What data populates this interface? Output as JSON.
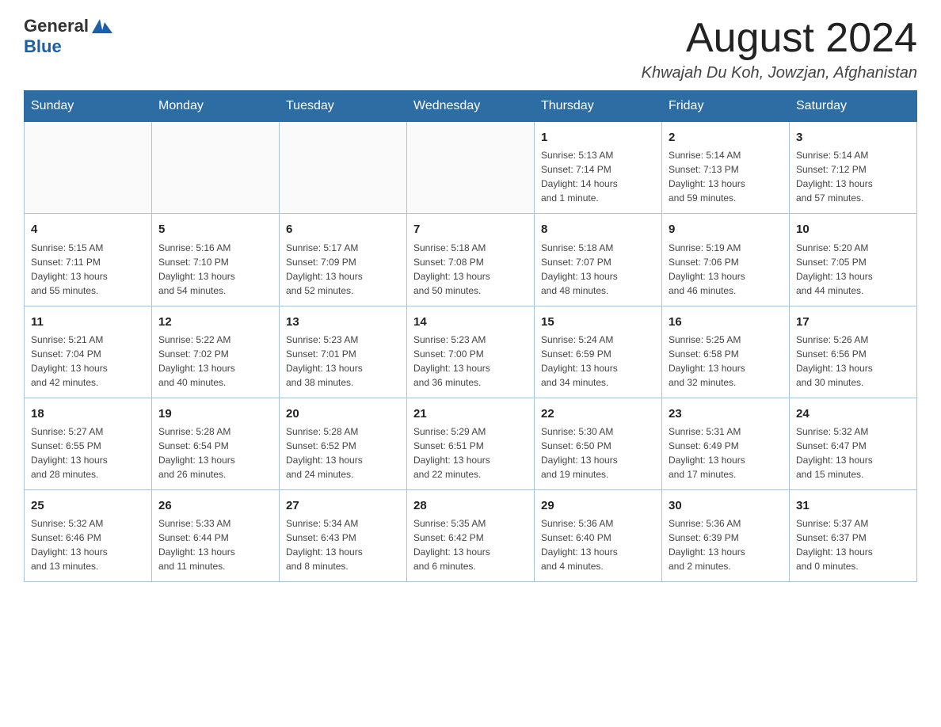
{
  "header": {
    "logo_general": "General",
    "logo_blue": "Blue",
    "month_title": "August 2024",
    "location": "Khwajah Du Koh, Jowzjan, Afghanistan"
  },
  "days_of_week": [
    "Sunday",
    "Monday",
    "Tuesday",
    "Wednesday",
    "Thursday",
    "Friday",
    "Saturday"
  ],
  "weeks": [
    [
      {
        "day": "",
        "info": ""
      },
      {
        "day": "",
        "info": ""
      },
      {
        "day": "",
        "info": ""
      },
      {
        "day": "",
        "info": ""
      },
      {
        "day": "1",
        "info": "Sunrise: 5:13 AM\nSunset: 7:14 PM\nDaylight: 14 hours\nand 1 minute."
      },
      {
        "day": "2",
        "info": "Sunrise: 5:14 AM\nSunset: 7:13 PM\nDaylight: 13 hours\nand 59 minutes."
      },
      {
        "day": "3",
        "info": "Sunrise: 5:14 AM\nSunset: 7:12 PM\nDaylight: 13 hours\nand 57 minutes."
      }
    ],
    [
      {
        "day": "4",
        "info": "Sunrise: 5:15 AM\nSunset: 7:11 PM\nDaylight: 13 hours\nand 55 minutes."
      },
      {
        "day": "5",
        "info": "Sunrise: 5:16 AM\nSunset: 7:10 PM\nDaylight: 13 hours\nand 54 minutes."
      },
      {
        "day": "6",
        "info": "Sunrise: 5:17 AM\nSunset: 7:09 PM\nDaylight: 13 hours\nand 52 minutes."
      },
      {
        "day": "7",
        "info": "Sunrise: 5:18 AM\nSunset: 7:08 PM\nDaylight: 13 hours\nand 50 minutes."
      },
      {
        "day": "8",
        "info": "Sunrise: 5:18 AM\nSunset: 7:07 PM\nDaylight: 13 hours\nand 48 minutes."
      },
      {
        "day": "9",
        "info": "Sunrise: 5:19 AM\nSunset: 7:06 PM\nDaylight: 13 hours\nand 46 minutes."
      },
      {
        "day": "10",
        "info": "Sunrise: 5:20 AM\nSunset: 7:05 PM\nDaylight: 13 hours\nand 44 minutes."
      }
    ],
    [
      {
        "day": "11",
        "info": "Sunrise: 5:21 AM\nSunset: 7:04 PM\nDaylight: 13 hours\nand 42 minutes."
      },
      {
        "day": "12",
        "info": "Sunrise: 5:22 AM\nSunset: 7:02 PM\nDaylight: 13 hours\nand 40 minutes."
      },
      {
        "day": "13",
        "info": "Sunrise: 5:23 AM\nSunset: 7:01 PM\nDaylight: 13 hours\nand 38 minutes."
      },
      {
        "day": "14",
        "info": "Sunrise: 5:23 AM\nSunset: 7:00 PM\nDaylight: 13 hours\nand 36 minutes."
      },
      {
        "day": "15",
        "info": "Sunrise: 5:24 AM\nSunset: 6:59 PM\nDaylight: 13 hours\nand 34 minutes."
      },
      {
        "day": "16",
        "info": "Sunrise: 5:25 AM\nSunset: 6:58 PM\nDaylight: 13 hours\nand 32 minutes."
      },
      {
        "day": "17",
        "info": "Sunrise: 5:26 AM\nSunset: 6:56 PM\nDaylight: 13 hours\nand 30 minutes."
      }
    ],
    [
      {
        "day": "18",
        "info": "Sunrise: 5:27 AM\nSunset: 6:55 PM\nDaylight: 13 hours\nand 28 minutes."
      },
      {
        "day": "19",
        "info": "Sunrise: 5:28 AM\nSunset: 6:54 PM\nDaylight: 13 hours\nand 26 minutes."
      },
      {
        "day": "20",
        "info": "Sunrise: 5:28 AM\nSunset: 6:52 PM\nDaylight: 13 hours\nand 24 minutes."
      },
      {
        "day": "21",
        "info": "Sunrise: 5:29 AM\nSunset: 6:51 PM\nDaylight: 13 hours\nand 22 minutes."
      },
      {
        "day": "22",
        "info": "Sunrise: 5:30 AM\nSunset: 6:50 PM\nDaylight: 13 hours\nand 19 minutes."
      },
      {
        "day": "23",
        "info": "Sunrise: 5:31 AM\nSunset: 6:49 PM\nDaylight: 13 hours\nand 17 minutes."
      },
      {
        "day": "24",
        "info": "Sunrise: 5:32 AM\nSunset: 6:47 PM\nDaylight: 13 hours\nand 15 minutes."
      }
    ],
    [
      {
        "day": "25",
        "info": "Sunrise: 5:32 AM\nSunset: 6:46 PM\nDaylight: 13 hours\nand 13 minutes."
      },
      {
        "day": "26",
        "info": "Sunrise: 5:33 AM\nSunset: 6:44 PM\nDaylight: 13 hours\nand 11 minutes."
      },
      {
        "day": "27",
        "info": "Sunrise: 5:34 AM\nSunset: 6:43 PM\nDaylight: 13 hours\nand 8 minutes."
      },
      {
        "day": "28",
        "info": "Sunrise: 5:35 AM\nSunset: 6:42 PM\nDaylight: 13 hours\nand 6 minutes."
      },
      {
        "day": "29",
        "info": "Sunrise: 5:36 AM\nSunset: 6:40 PM\nDaylight: 13 hours\nand 4 minutes."
      },
      {
        "day": "30",
        "info": "Sunrise: 5:36 AM\nSunset: 6:39 PM\nDaylight: 13 hours\nand 2 minutes."
      },
      {
        "day": "31",
        "info": "Sunrise: 5:37 AM\nSunset: 6:37 PM\nDaylight: 13 hours\nand 0 minutes."
      }
    ]
  ],
  "colors": {
    "header_bg": "#2e6da4",
    "header_text": "#ffffff",
    "border": "#aac4e0"
  }
}
